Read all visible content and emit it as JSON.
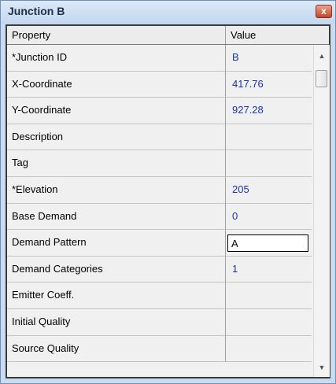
{
  "window": {
    "title": "Junction B",
    "close_label": "x"
  },
  "grid": {
    "headers": {
      "property": "Property",
      "value": "Value"
    },
    "rows": [
      {
        "property": "*Junction ID",
        "value": "B"
      },
      {
        "property": "X-Coordinate",
        "value": "417.76"
      },
      {
        "property": "Y-Coordinate",
        "value": "927.28"
      },
      {
        "property": "Description",
        "value": ""
      },
      {
        "property": "Tag",
        "value": ""
      },
      {
        "property": "*Elevation",
        "value": "205"
      },
      {
        "property": "Base Demand",
        "value": "0"
      },
      {
        "property": "Demand Pattern",
        "value": "A"
      },
      {
        "property": "Demand Categories",
        "value": "1"
      },
      {
        "property": "Emitter Coeff.",
        "value": ""
      },
      {
        "property": "Initial Quality",
        "value": ""
      },
      {
        "property": "Source Quality",
        "value": ""
      }
    ]
  },
  "scrollbar": {
    "up_icon": "arrow-up-icon",
    "down_icon": "arrow-down-icon"
  }
}
